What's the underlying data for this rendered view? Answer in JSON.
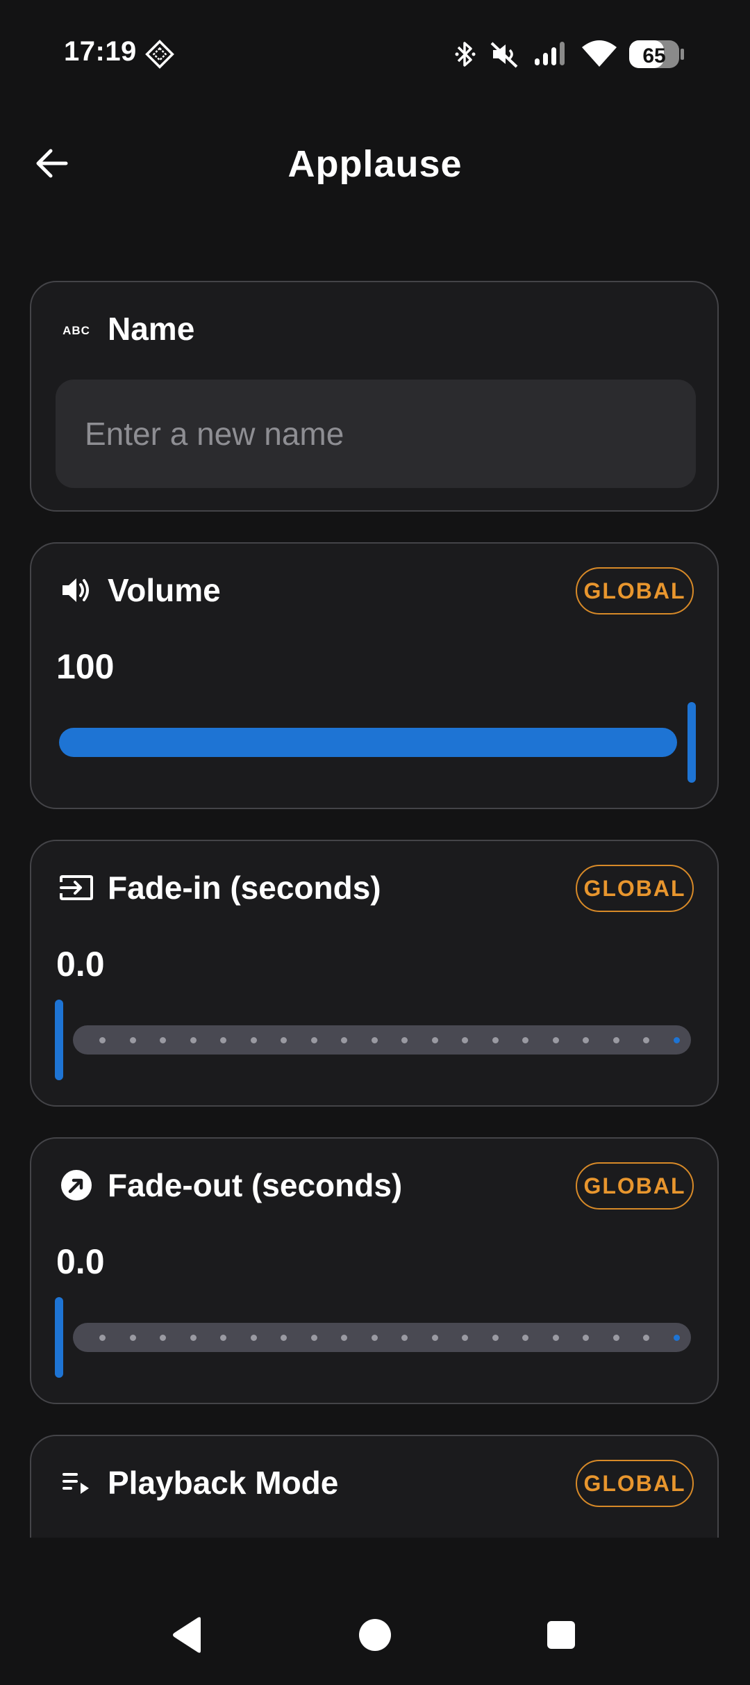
{
  "status_bar": {
    "time": "17:19",
    "battery": "65",
    "icons": [
      "dnd-diamond-icon",
      "bluetooth-icon",
      "muted-speaker-icon",
      "signal-icon",
      "wifi-icon",
      "battery-icon"
    ]
  },
  "app_bar": {
    "title": "Applause",
    "back_icon": "arrow-left-icon"
  },
  "name_card": {
    "icon": "abc-text-icon",
    "title": "Name",
    "input_placeholder": "Enter a new name",
    "input_value": ""
  },
  "volume_card": {
    "icon": "speaker-icon",
    "title": "Volume",
    "badge": "GLOBAL",
    "value": "100",
    "slider_fraction": 1.0
  },
  "fadein_card": {
    "icon": "login-arrow-icon",
    "title": "Fade-in (seconds)",
    "badge": "GLOBAL",
    "value": "0.0",
    "slider_fraction": 0.0
  },
  "fadeout_card": {
    "icon": "arrow-up-right-circle-icon",
    "title": "Fade-out (seconds)",
    "badge": "GLOBAL",
    "value": "0.0",
    "slider_fraction": 0.0
  },
  "playback_card": {
    "icon": "playlist-play-icon",
    "title": "Playback Mode",
    "badge": "GLOBAL"
  },
  "nav_bar": {
    "items": [
      "back-triangle-icon",
      "home-circle-icon",
      "recents-square-icon"
    ]
  },
  "colors": {
    "background": "#131314",
    "card": "#1b1b1d",
    "accent_blue": "#1e74d4",
    "badge_orange": "#e8962e"
  }
}
